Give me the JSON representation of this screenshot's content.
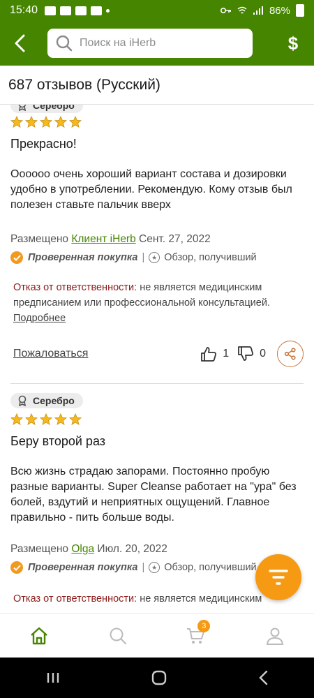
{
  "status_bar": {
    "time": "15:40",
    "battery": "86%"
  },
  "header": {
    "search_placeholder": "Поиск на iHerb",
    "currency_symbol": "$"
  },
  "title": "687 отзывов (Русский)",
  "reviews": [
    {
      "badge": "Серебро",
      "rating": 5,
      "title": "Прекрасно!",
      "text": "Оооооо очень хороший вариант состава и дозировки удобно в употреблении. Рекомендую. Кому отзыв был полезен ставьте пальчик вверх",
      "posted_prefix": "Размещено",
      "author": "Клиент iHerb",
      "date": "Сент. 27, 2022",
      "verified": "Проверенная покупка",
      "separator": "|",
      "review_type": "Обзор, получивший",
      "disclaimer_label": "Отказ от ответственности:",
      "disclaimer_text": " не является медицинским предписанием или профессиональной консультацией.",
      "more": "Подробнее",
      "report": "Пожаловаться",
      "likes": "1",
      "dislikes": "0"
    },
    {
      "badge": "Серебро",
      "rating": 5,
      "title": "Беру второй раз",
      "text": "Всю жизнь страдаю запорами. Постоянно пробую разные варианты. Super Cleanse работает на \"ура\" без болей, вздутий и неприятных ощущений. Главное правильно - пить больше воды.",
      "posted_prefix": "Размещено",
      "author": "Olga",
      "date": "Июл. 20, 2022",
      "verified": "Проверенная покупка",
      "separator": "|",
      "review_type": "Обзор, получивший",
      "disclaimer_label": "Отказ от ответственности:",
      "disclaimer_text": " не является медицинским"
    }
  ],
  "bottom_nav": {
    "cart_count": "3"
  },
  "colors": {
    "brand_green": "#458500",
    "accent_orange": "#f59a12",
    "star_gold": "#f6b81c"
  }
}
